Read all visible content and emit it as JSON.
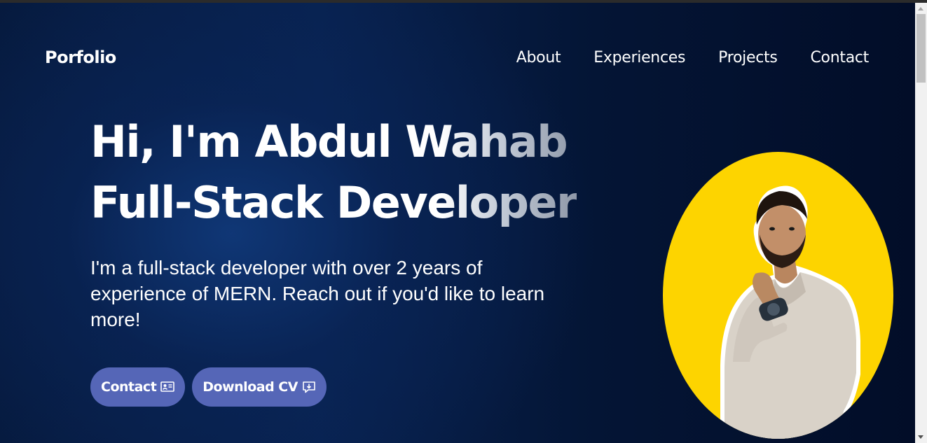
{
  "brand": "Porfolio",
  "nav": [
    "About",
    "Experiences",
    "Projects",
    "Contact"
  ],
  "hero": {
    "line1": "Hi, I'm Abdul Wahab",
    "line2": "Full-Stack Developer",
    "description": "I'm a full-stack developer with over 2 years of experience of MERN. Reach out if you'd like to learn more!"
  },
  "buttons": {
    "contact": "Contact",
    "contact_icon": "contact-card-icon",
    "download": "Download CV",
    "download_icon": "download-icon"
  },
  "portrait": {
    "background": "#fdd400",
    "icon": "profile-photo"
  },
  "colors": {
    "accent": "#5566b7",
    "page_bg": "#061a3e"
  }
}
